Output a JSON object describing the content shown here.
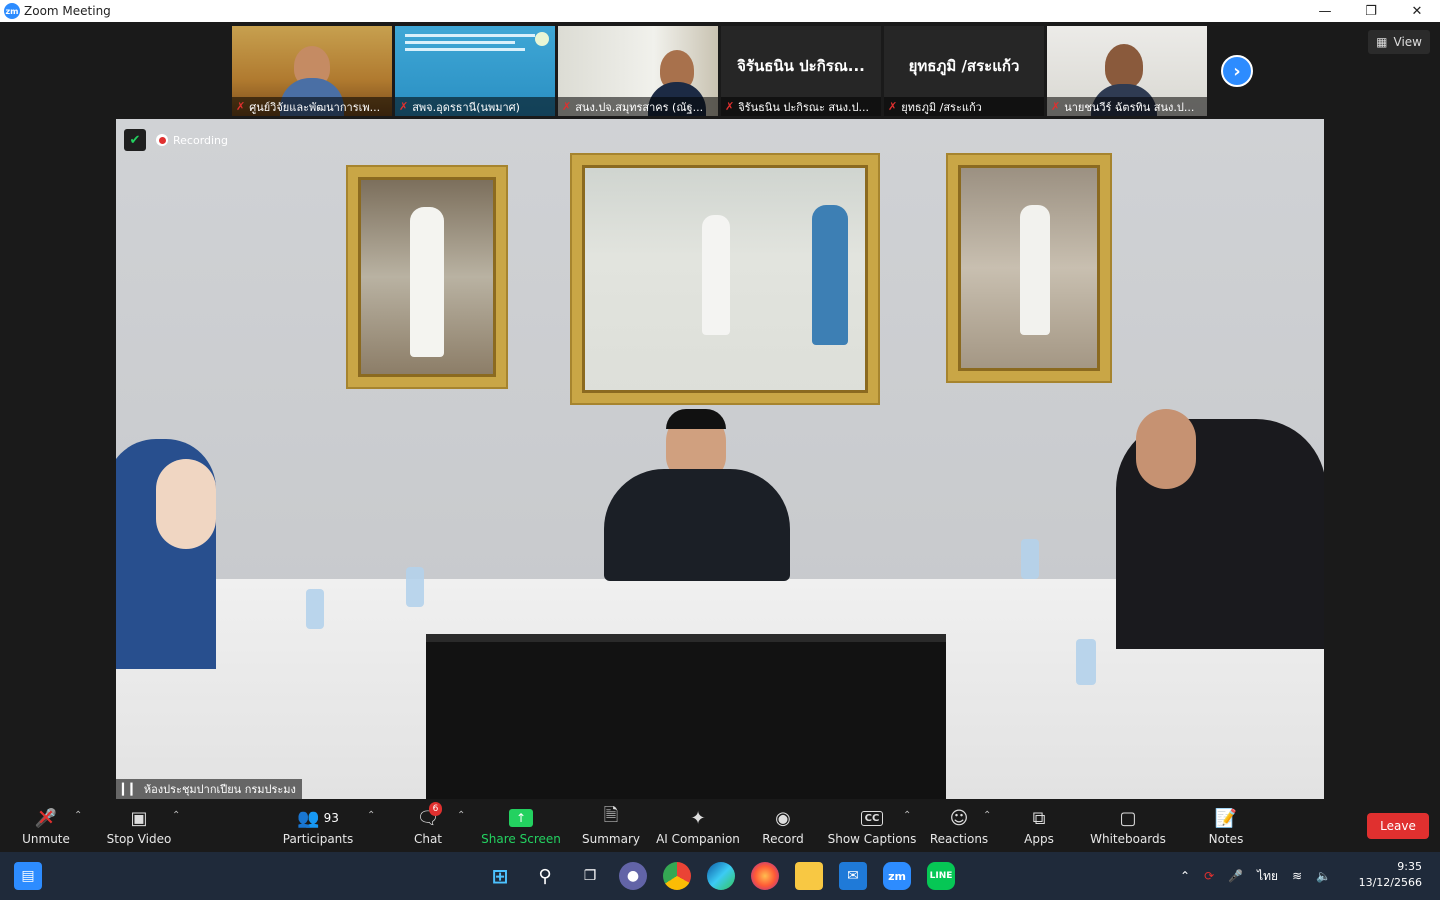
{
  "window": {
    "title": "Zoom Meeting",
    "logo_text": "zm"
  },
  "view_button": {
    "label": "View"
  },
  "thumbnails": [
    {
      "name": "ศูนย์วิจัยและพัฒนาการเพ...",
      "muted": true
    },
    {
      "name": "สพจ.อุดรธานี(นพมาศ)",
      "muted": true
    },
    {
      "name": "สนง.ปจ.สมุทรสาคร (ณัฐ...",
      "muted": true
    },
    {
      "name": "จิรันธนิน ปะกิรณะ สนง.ป...",
      "display_name": "จิรันธนิน ปะกิรณ...",
      "muted": true
    },
    {
      "name": "ยุทธภูมิ /สระแก้ว",
      "display_name": "ยุทธภูมิ /สระแก้ว",
      "muted": true
    },
    {
      "name": "นายชนวีร์ ฉัตรทิน สนง.ป...",
      "muted": true
    }
  ],
  "main_video": {
    "recording_label": "Recording",
    "room_label": "ห้องประชุมปากเปียน กรมประมง"
  },
  "toolbar": {
    "unmute": "Unmute",
    "stop_video": "Stop Video",
    "participants": "Participants",
    "participants_count": "93",
    "chat": "Chat",
    "chat_badge": "6",
    "share_screen": "Share Screen",
    "summary": "Summary",
    "ai_companion": "AI Companion",
    "record": "Record",
    "show_captions": "Show Captions",
    "cc": "CC",
    "reactions": "Reactions",
    "apps": "Apps",
    "whiteboards": "Whiteboards",
    "notes": "Notes",
    "leave": "Leave"
  },
  "taskbar": {
    "language": "ไทย",
    "time": "9:35",
    "date": "13/12/2566"
  },
  "colors": {
    "zoom_blue": "#2d8cff",
    "leave_red": "#e0302f",
    "share_green": "#23d160"
  }
}
